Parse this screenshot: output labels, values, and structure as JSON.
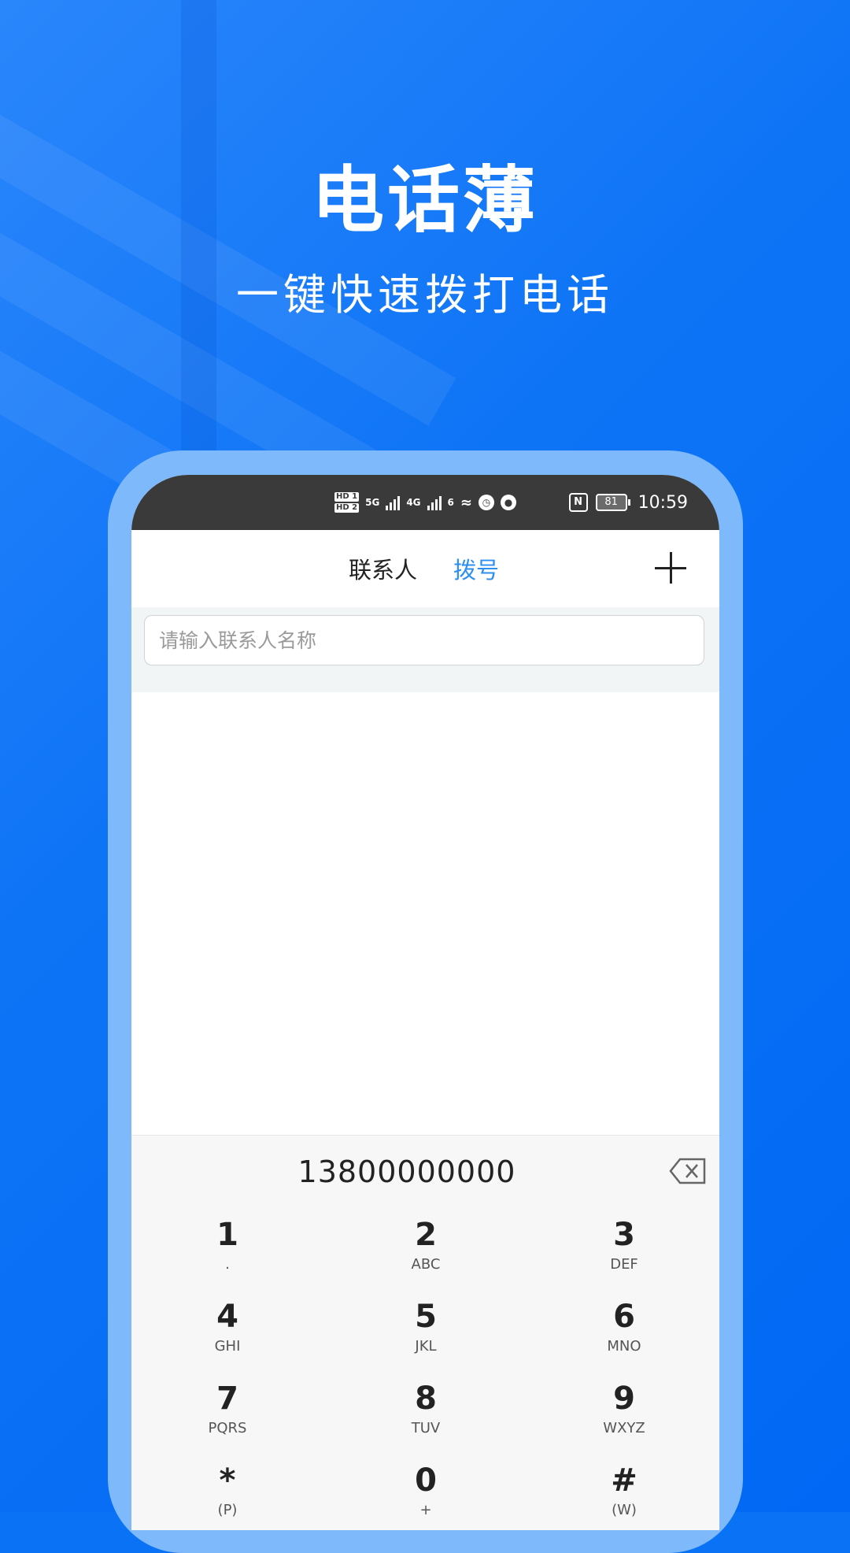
{
  "hero": {
    "title": "电话薄",
    "subtitle": "一键快速拨打电话"
  },
  "status_bar": {
    "hd1": "HD 1",
    "hd2": "HD 2",
    "net1": "5G",
    "net2": "4G",
    "wifi_tag": "6",
    "nfc": "N",
    "battery": "81",
    "time": "10:59"
  },
  "header": {
    "tab_contacts": "联系人",
    "tab_dial": "拨号",
    "active_tab": "拨号",
    "active_color": "#2d8ff0"
  },
  "search": {
    "placeholder": "请输入联系人名称",
    "value": ""
  },
  "dialpad": {
    "number": "13800000000",
    "keys": [
      {
        "digit": "1",
        "letters": "."
      },
      {
        "digit": "2",
        "letters": "ABC"
      },
      {
        "digit": "3",
        "letters": "DEF"
      },
      {
        "digit": "4",
        "letters": "GHI"
      },
      {
        "digit": "5",
        "letters": "JKL"
      },
      {
        "digit": "6",
        "letters": "MNO"
      },
      {
        "digit": "7",
        "letters": "PQRS"
      },
      {
        "digit": "8",
        "letters": "TUV"
      },
      {
        "digit": "9",
        "letters": "WXYZ"
      },
      {
        "digit": "*",
        "letters": "(P)"
      },
      {
        "digit": "0",
        "letters": "+"
      },
      {
        "digit": "#",
        "letters": "(W)"
      }
    ]
  },
  "colors": {
    "background": "#0a72f5",
    "frame": "#7eb9fb",
    "status_bar": "#3a3a3a",
    "accent": "#2d8ff0"
  }
}
